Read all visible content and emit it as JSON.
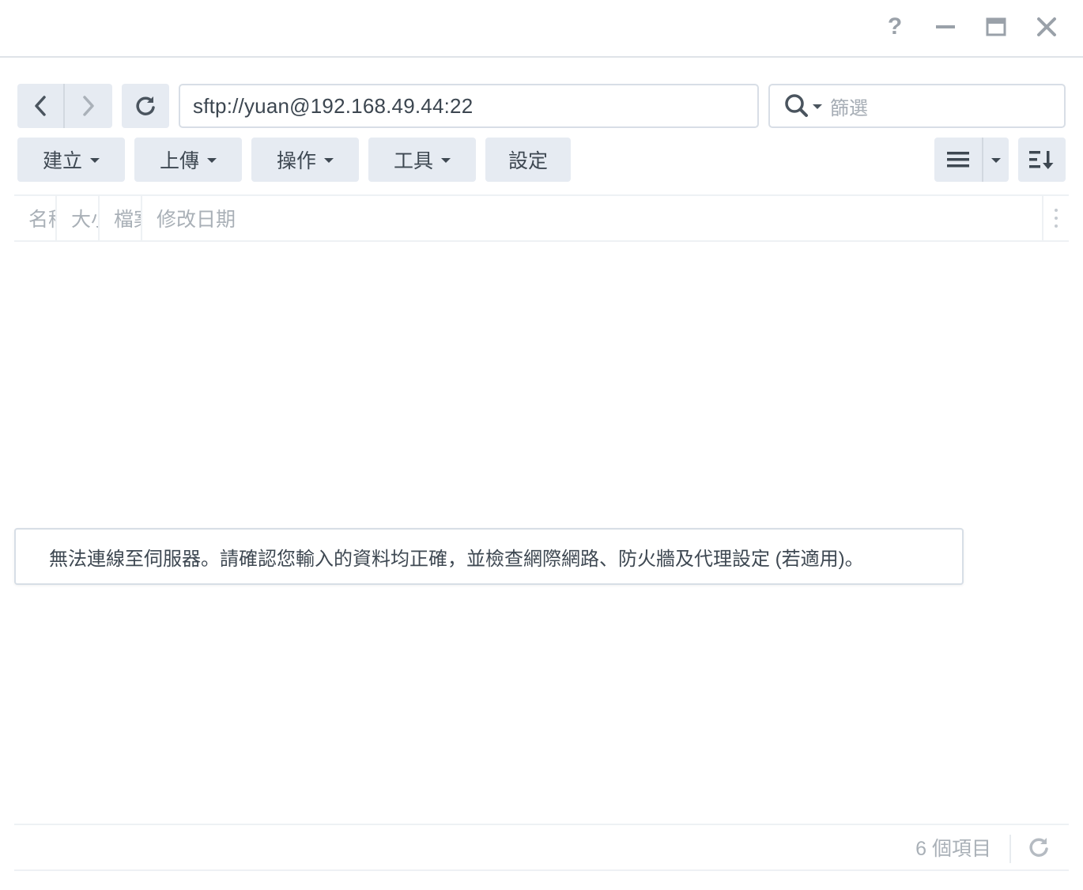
{
  "window": {
    "controls": {
      "help_label": "?",
      "help_icon": "question-icon",
      "minimize_icon": "minimize-icon",
      "maximize_icon": "maximize-icon",
      "close_icon": "close-icon"
    }
  },
  "navigation": {
    "back_icon": "chevron-left-icon",
    "forward_icon": "chevron-right-icon",
    "refresh_icon": "refresh-icon",
    "address": "sftp://yuan@192.168.49.44:22"
  },
  "filter": {
    "placeholder": "篩選",
    "icon": "search-icon"
  },
  "toolbar": {
    "create_label": "建立",
    "upload_label": "上傳",
    "action_label": "操作",
    "tools_label": "工具",
    "settings_label": "設定",
    "view_icon": "list-view-icon",
    "sort_icon": "sort-icon"
  },
  "columns": [
    "名稱",
    "大小",
    "檔案類型",
    "修改日期"
  ],
  "error_message": "無法連線至伺服器。請確認您輸入的資料均正確，並檢查網際網路、防火牆及代理設定 (若適用)。",
  "status": {
    "item_count": "6 個項目"
  },
  "colors": {
    "button_bg": "#e6ebf2",
    "border": "#d8dee6",
    "text": "#3e4852",
    "muted_text": "#a9b0b7"
  }
}
